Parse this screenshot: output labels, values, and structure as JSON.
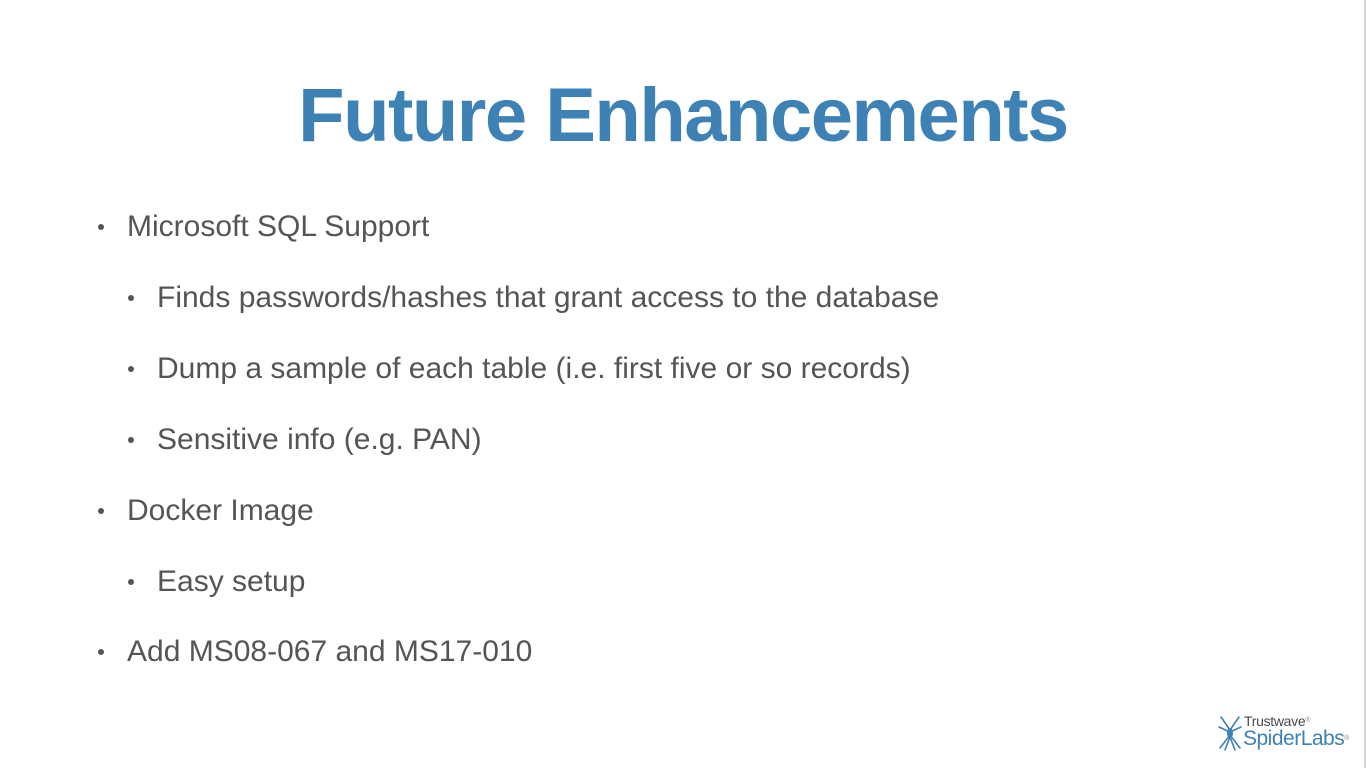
{
  "slide": {
    "title": "Future Enhancements",
    "title_color": "#3e82b5",
    "text_color": "#555555",
    "bullets": [
      {
        "level": 1,
        "text": "Microsoft SQL Support"
      },
      {
        "level": 2,
        "text": "Finds passwords/hashes that grant access to the database"
      },
      {
        "level": 2,
        "text": "Dump a sample of each table (i.e. first five or so records)"
      },
      {
        "level": 2,
        "text": "Sensitive info (e.g. PAN)"
      },
      {
        "level": 1,
        "text": "Docker Image"
      },
      {
        "level": 2,
        "text": "Easy setup"
      },
      {
        "level": 1,
        "text": "Add MS08-067 and MS17-010"
      }
    ]
  },
  "logo": {
    "brand_top": "Trustwave",
    "registered_mark": "®",
    "brand_bottom": "SpiderLabs",
    "registered_mark_bottom": "®",
    "icon": "spider-icon"
  }
}
